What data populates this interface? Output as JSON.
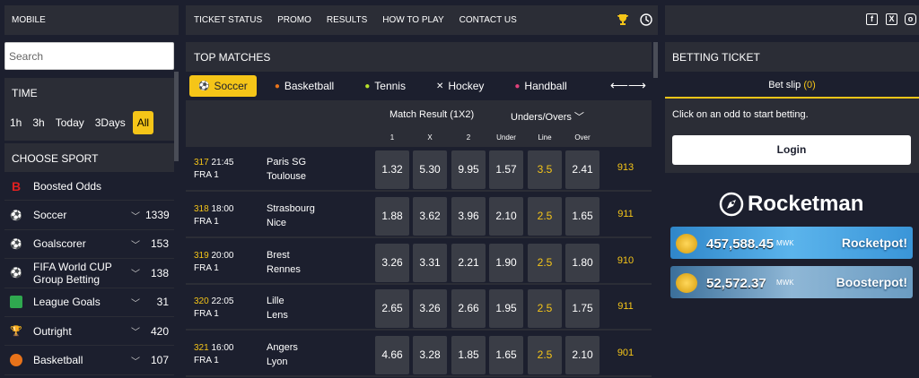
{
  "left": {
    "mobile_label": "MOBILE",
    "search_placeholder": "Search",
    "time": {
      "title": "TIME",
      "options": [
        "1h",
        "3h",
        "Today",
        "3Days",
        "All"
      ],
      "selected": "All"
    },
    "choose_sport": {
      "title": "CHOOSE SPORT",
      "items": [
        {
          "label": "Boosted Odds",
          "count": "",
          "icon": "boosted-b-icon"
        },
        {
          "label": "Soccer",
          "count": "1339",
          "icon": "soccer-ball-icon"
        },
        {
          "label": "Goalscorer",
          "count": "153",
          "icon": "goalscorer-icon"
        },
        {
          "label": "FIFA World CUP Group Betting",
          "count": "138",
          "icon": "soccer-ball-icon"
        },
        {
          "label": "League Goals",
          "count": "31",
          "icon": "league-goals-icon"
        },
        {
          "label": "Outright",
          "count": "420",
          "icon": "trophy-icon"
        },
        {
          "label": "Basketball",
          "count": "107",
          "icon": "basketball-icon"
        }
      ]
    }
  },
  "nav": {
    "links": [
      "TICKET STATUS",
      "PROMO",
      "RESULTS",
      "HOW TO PLAY",
      "CONTACT US"
    ],
    "icons": [
      "trophy-icon",
      "clock-icon"
    ]
  },
  "main": {
    "title": "TOP MATCHES",
    "sport_tabs": [
      {
        "label": "Soccer",
        "icon": "soccer-ball-icon",
        "active": true
      },
      {
        "label": "Basketball",
        "icon": "basketball-icon",
        "active": false
      },
      {
        "label": "Tennis",
        "icon": "tennis-ball-icon",
        "active": false
      },
      {
        "label": "Hockey",
        "icon": "hockey-sticks-icon",
        "active": false
      },
      {
        "label": "Handball",
        "icon": "handball-icon",
        "active": false
      }
    ],
    "market_titles": {
      "result": "Match Result (1X2)",
      "unders": "Unders/Overs"
    },
    "columns": [
      "1",
      "X",
      "2",
      "Under",
      "Line",
      "Over"
    ],
    "matches": [
      {
        "id": "317",
        "time": "21:45",
        "league": "FRA 1",
        "home": "Paris SG",
        "away": "Toulouse",
        "odds": [
          "1.32",
          "5.30",
          "9.95",
          "1.57",
          "3.5",
          "2.41"
        ],
        "more": "913"
      },
      {
        "id": "318",
        "time": "18:00",
        "league": "FRA 1",
        "home": "Strasbourg",
        "away": "Nice",
        "odds": [
          "1.88",
          "3.62",
          "3.96",
          "2.10",
          "2.5",
          "1.65"
        ],
        "more": "911"
      },
      {
        "id": "319",
        "time": "20:00",
        "league": "FRA 1",
        "home": "Brest",
        "away": "Rennes",
        "odds": [
          "3.26",
          "3.31",
          "2.21",
          "1.90",
          "2.5",
          "1.80"
        ],
        "more": "910"
      },
      {
        "id": "320",
        "time": "22:05",
        "league": "FRA 1",
        "home": "Lille",
        "away": "Lens",
        "odds": [
          "2.65",
          "3.26",
          "2.66",
          "1.95",
          "2.5",
          "1.75"
        ],
        "more": "911"
      },
      {
        "id": "321",
        "time": "16:00",
        "league": "FRA 1",
        "home": "Angers",
        "away": "Lyon",
        "odds": [
          "4.66",
          "3.28",
          "1.85",
          "1.65",
          "2.5",
          "2.10"
        ],
        "more": "901"
      }
    ]
  },
  "right": {
    "social_icons": [
      "facebook-icon",
      "x-icon",
      "instagram-icon"
    ],
    "ticket": {
      "title": "BETTING TICKET",
      "slip_label": "Bet slip",
      "slip_count": "(0)",
      "message": "Click on an odd to start betting.",
      "login": "Login"
    },
    "rocketman": {
      "logo": "Rocketman",
      "rocketpot_amount": "457,588.45",
      "rocketpot_currency": "MWK",
      "rocketpot_label": "Rocketpot!",
      "boosterpot_amount": "52,572.37",
      "boosterpot_currency": "MWK",
      "boosterpot_label": "Boosterpot!"
    }
  },
  "colors": {
    "accent": "#f5c518",
    "panel": "#2b2d36",
    "background": "#1c1f2e"
  }
}
